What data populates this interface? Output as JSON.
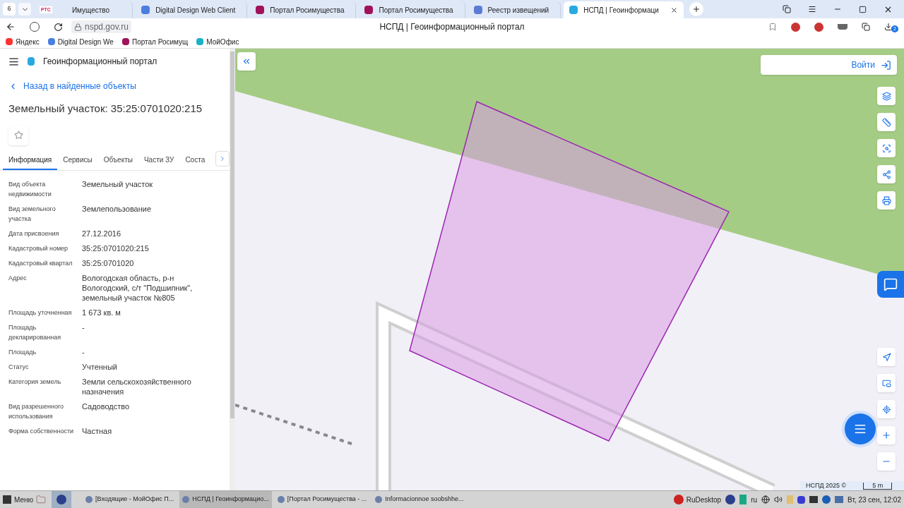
{
  "browser": {
    "tab_count": "6",
    "tabs": [
      {
        "label": "Имущество",
        "logo": "РТС",
        "selected": false
      },
      {
        "label": "Digital Design Web Client",
        "selected": false
      },
      {
        "label": "Портал Росимущества",
        "selected": false
      },
      {
        "label": "Портал Росимущества",
        "selected": false
      },
      {
        "label": "Реестр извещений",
        "selected": false
      },
      {
        "label": "НСПД | Геоинформаци",
        "selected": true
      }
    ],
    "url": "nspd.gov.ru",
    "page_title": "НСПД | Геоинформационный портал",
    "downloads_badge": "2",
    "bookmarks": [
      "Яндекс",
      "Digital Design We",
      "Портал Росимущ",
      "МойОфис"
    ]
  },
  "panel": {
    "portal_title": "Геоинформационный портал",
    "back_link": "Назад в найденные объекты",
    "title": "Земельный участок: 35:25:0701020:215",
    "tabs": [
      {
        "label": "Информация",
        "selected": true
      },
      {
        "label": "Сервисы",
        "selected": false
      },
      {
        "label": "Объекты",
        "selected": false
      },
      {
        "label": "Части ЗУ",
        "selected": false
      },
      {
        "label": "Соста",
        "selected": false
      }
    ],
    "fields": [
      {
        "label": "Вид объекта недвижимости",
        "value": "Земельный участок"
      },
      {
        "label": "Вид земельного участка",
        "value": "Землепользование"
      },
      {
        "label": "Дата присвоения",
        "value": "27.12.2016"
      },
      {
        "label": "Кадастровый номер",
        "value": "35:25:0701020:215"
      },
      {
        "label": "Кадастровый квартал",
        "value": "35:25:0701020"
      },
      {
        "label": "Адрес",
        "value": "Вологодская область, р-н Вологодский, с/т \"Подшипник\", земельный участок №805"
      },
      {
        "label": "Площадь уточненная",
        "value": "1 673 кв. м"
      },
      {
        "label": "Площадь декларированная",
        "value": "-"
      },
      {
        "label": "Площадь",
        "value": "-"
      },
      {
        "label": "Статус",
        "value": "Учтенный"
      },
      {
        "label": "Категория земель",
        "value": "Земли сельскохозяйственного назначения"
      },
      {
        "label": "Вид разрешенного использования",
        "value": "Садоводство"
      },
      {
        "label": "Форма собственности",
        "value": "Частная"
      }
    ]
  },
  "map": {
    "login": "Войти",
    "attribution": "НСПД 2025 ©",
    "scale": "5 m"
  },
  "taskbar": {
    "menu": "Меню",
    "windows": [
      {
        "label": "[Входящие - МойОфис П...",
        "selected": false
      },
      {
        "label": "НСПД | Геоинформацио...",
        "selected": true
      },
      {
        "label": "[Портал Росимущества - ...",
        "selected": false
      },
      {
        "label": "Informacionnoe soobshhe...",
        "selected": false
      }
    ],
    "tray_app": "RuDesktop",
    "layout": "ru",
    "clock": "Вт, 23 сен, 12:02"
  }
}
